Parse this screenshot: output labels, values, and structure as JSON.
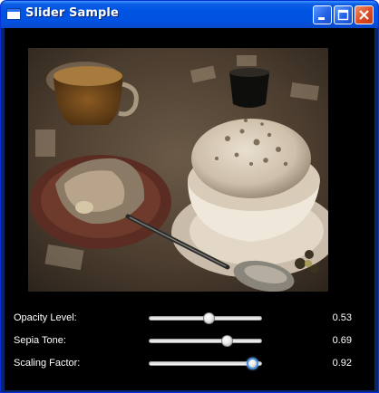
{
  "window": {
    "title": "Slider Sample",
    "minimize_icon": "minimize-icon",
    "maximize_icon": "maximize-icon",
    "close_icon": "close-icon"
  },
  "colors": {
    "title_bar": "#0054e3",
    "background": "#000000",
    "text": "#ffffff",
    "focus_ring": "#4a90e2"
  },
  "image": {
    "description_icon": "photo-image"
  },
  "sliders": [
    {
      "label": "Opacity Level:",
      "value": 0.53,
      "value_text": "0.53",
      "focused": false
    },
    {
      "label": "Sepia Tone:",
      "value": 0.69,
      "value_text": "0.69",
      "focused": false
    },
    {
      "label": "Scaling Factor:",
      "value": 0.92,
      "value_text": "0.92",
      "focused": true
    }
  ]
}
